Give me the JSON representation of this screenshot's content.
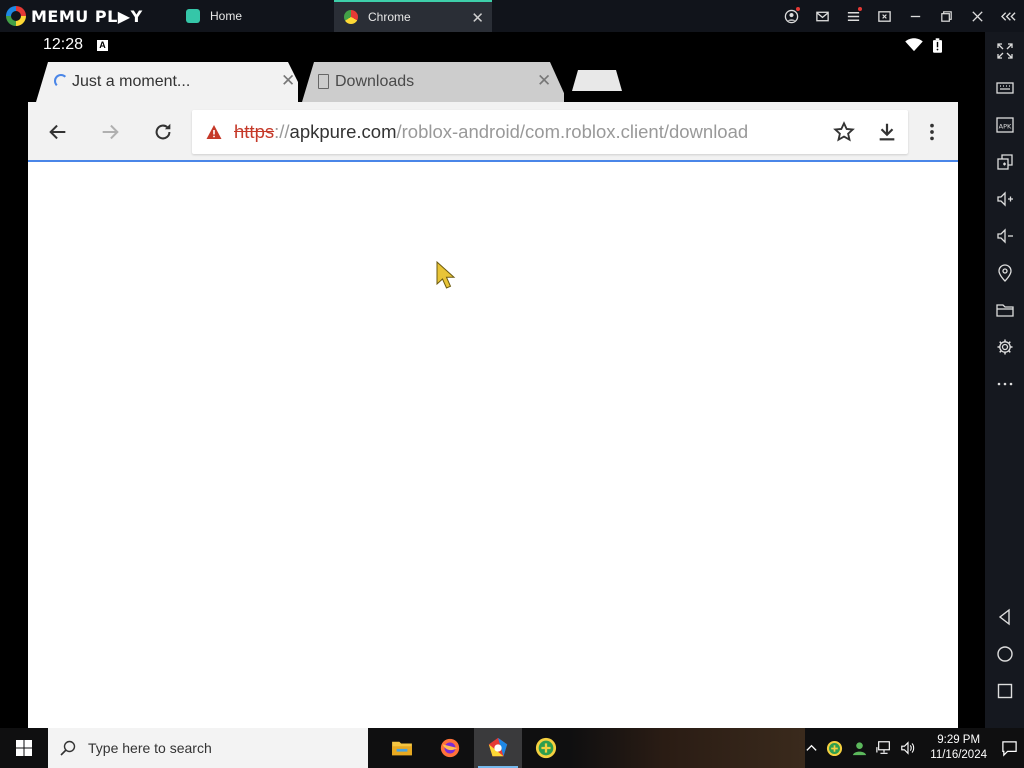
{
  "memu": {
    "logo_text": "MEMU PL▶Y",
    "tabs": [
      {
        "label": "Home",
        "icon": "memu-home-icon"
      },
      {
        "label": "Chrome",
        "icon": "chrome-icon"
      }
    ],
    "accent": "#3ecfaa"
  },
  "android": {
    "status": {
      "time": "12:28",
      "badge": "A"
    },
    "chrome": {
      "tabs": [
        {
          "title": "Just a moment...",
          "state": "loading"
        },
        {
          "title": "Downloads"
        }
      ],
      "url": {
        "scheme": "https",
        "separator": "://",
        "host": "apkpure.com",
        "path": "/roblox-android/com.roblox.client/download"
      },
      "security": "not-secure"
    }
  },
  "taskbar": {
    "search_placeholder": "Type here to search",
    "clock_time": "9:29 PM",
    "clock_date": "11/16/2024",
    "pinned": [
      "file-explorer-icon",
      "firefox-icon",
      "memu-icon",
      "plus-app-icon"
    ]
  }
}
